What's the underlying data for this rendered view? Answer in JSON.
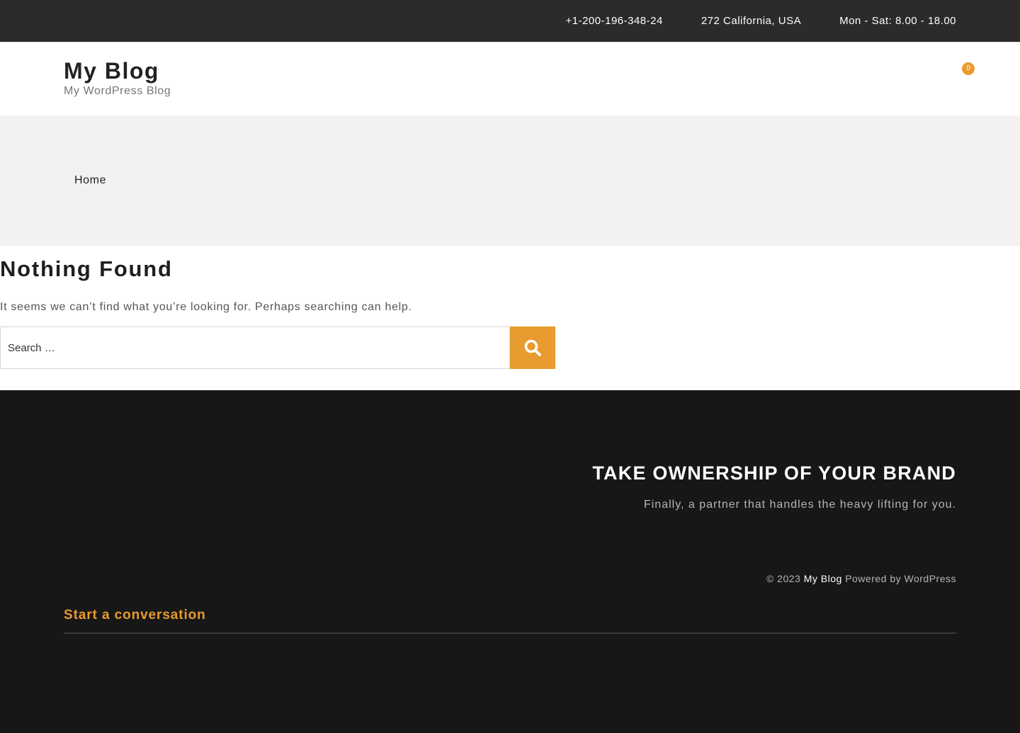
{
  "topbar": {
    "social_icons": [
      "social-icon-1",
      "social-icon-2",
      "social-icon-3",
      "social-icon-4",
      "social-icon-5",
      "social-icon-6"
    ],
    "phone": "+1-200-196-348-24",
    "address": "272 California, USA",
    "hours": "Mon - Sat: 8.00 - 18.00",
    "icon_glyph": ""
  },
  "header": {
    "site_title": "My Blog",
    "tagline": "My WordPress Blog",
    "search_glyph": "",
    "cart_count": "0"
  },
  "breadcrumb": {
    "home": "Home"
  },
  "main": {
    "title": "Nothing Found",
    "message": "It seems we can’t find what you’re looking for. Perhaps searching can help.",
    "search_placeholder": "Search …"
  },
  "footer": {
    "heading": "TAKE OWNERSHIP OF YOUR BRAND",
    "subheading": "Finally, a partner that handles the heavy lifting for you.",
    "copyright_prefix": "© 2023",
    "site_link": "My Blog",
    "powered_by": "Powered by WordPress",
    "conversation": "Start a conversation"
  },
  "colors": {
    "accent": "#e89b2f",
    "topbar_bg": "#2b2b2b",
    "footer_bg": "#171717",
    "band_bg": "#f2f2f2"
  }
}
